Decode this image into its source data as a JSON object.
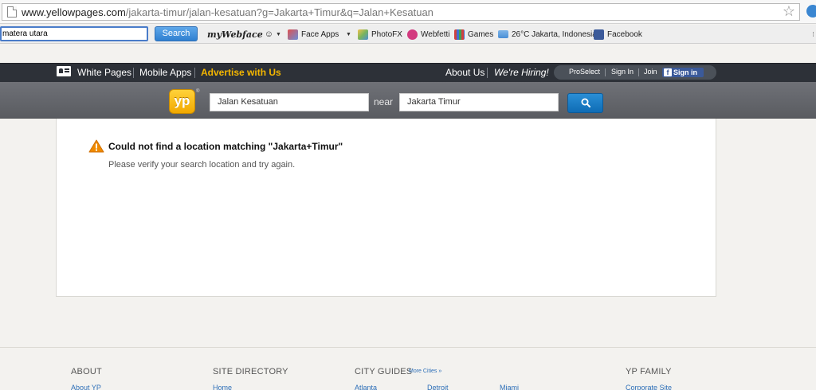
{
  "browser": {
    "url_host": "www.yellowpages.com",
    "url_path": "/jakarta-timur/jalan-kesatuan?g=Jakarta+Timur&q=Jalan+Kesatuan"
  },
  "toolbar": {
    "search_value": "matera utara",
    "search_button": "Search",
    "webface_logo": "myWebface",
    "face_apps": "Face Apps",
    "photofx": "PhotoFX",
    "webfetti": "Webfetti",
    "games": "Games",
    "weather": "26°C Jakarta, Indonesia",
    "facebook": "Facebook"
  },
  "topnav": {
    "white_pages": "White Pages",
    "mobile_apps": "Mobile Apps",
    "advertise": "Advertise with Us",
    "about_us": "About Us",
    "hiring": "We're Hiring!",
    "proselect": "ProSelect",
    "sign_in": "Sign In",
    "join": "Join",
    "fb_sign_in": "Sign in"
  },
  "search": {
    "logo": "yp",
    "query": "Jalan Kesatuan",
    "near_label": "near",
    "location": "Jakarta Timur"
  },
  "error": {
    "title": "Could not find a location matching \"Jakarta+Timur\"",
    "detail": "Please verify your search location and try again."
  },
  "footer": {
    "about_heading": "ABOUT",
    "site_directory_heading": "SITE DIRECTORY",
    "city_guides_heading": "CITY GUIDES",
    "more_cities": "More Cities »",
    "yp_family_heading": "YP FAMILY",
    "about_yp": "About YP",
    "home": "Home",
    "atlanta": "Atlanta",
    "detroit": "Detroit",
    "miami": "Miami",
    "corporate_site": "Corporate Site"
  },
  "colors": {
    "nav_bg": "#2d3138",
    "advertise": "#f5b700",
    "search_button": "#0f6cb5",
    "yp_logo": "#f2a900",
    "warning": "#f08a00"
  }
}
